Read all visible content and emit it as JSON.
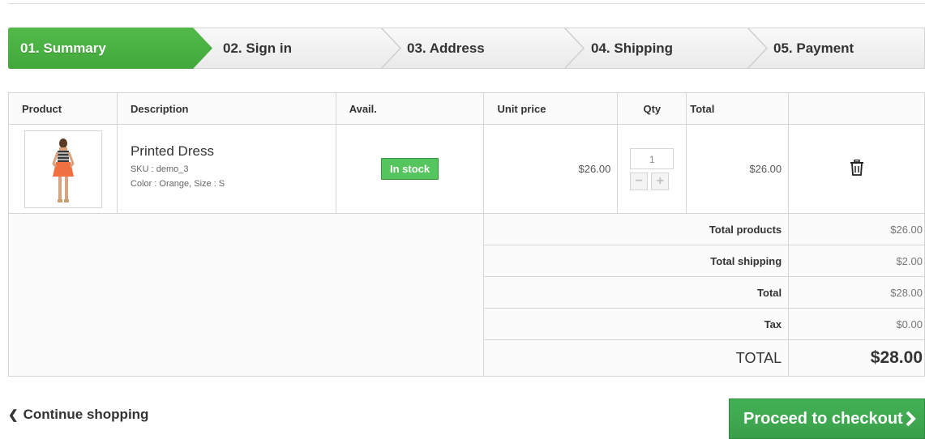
{
  "steps": [
    {
      "label": "01. Summary",
      "active": true
    },
    {
      "label": "02. Sign in",
      "active": false
    },
    {
      "label": "03. Address",
      "active": false
    },
    {
      "label": "04. Shipping",
      "active": false
    },
    {
      "label": "05. Payment",
      "active": false
    }
  ],
  "table": {
    "headers": [
      "Product",
      "Description",
      "Avail.",
      "Unit price",
      "Qty",
      "Total"
    ],
    "item": {
      "name": "Printed Dress",
      "sku": "SKU : demo_3",
      "attributes": "Color : Orange, Size : S",
      "availability": "In stock",
      "unit_price": "$26.00",
      "qty": "1",
      "total": "$26.00",
      "delete_icon": "trash-icon"
    },
    "summary": [
      {
        "label": "Total products",
        "value": "$26.00"
      },
      {
        "label": "Total shipping",
        "value": "$2.00"
      },
      {
        "label": "Total",
        "value": "$28.00"
      },
      {
        "label": "Tax",
        "value": "$0.00"
      }
    ],
    "grand_total": {
      "label": "TOTAL",
      "value": "$28.00"
    }
  },
  "actions": {
    "continue_label": "Continue shopping",
    "checkout_label": "Proceed to checkout"
  },
  "colors": {
    "accent_green": "#4cb748",
    "stock_green": "#55c65e",
    "border": "#d6d4d4"
  }
}
